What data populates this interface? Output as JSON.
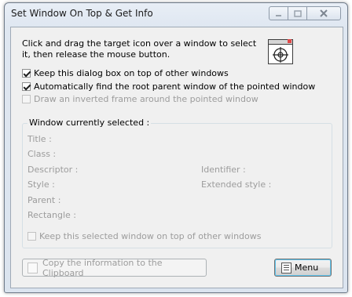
{
  "window": {
    "title": "Set Window On Top & Get Info"
  },
  "instructions": "Click and drag the target icon over a window to select it, then release the mouse button.",
  "options": [
    {
      "label": "Keep this dialog box on top of other windows",
      "checked": true,
      "enabled": true
    },
    {
      "label": "Automatically find the root parent window of the pointed window",
      "checked": true,
      "enabled": true
    },
    {
      "label": "Draw an inverted frame around the pointed window",
      "checked": false,
      "enabled": false
    }
  ],
  "group": {
    "legend": "Window currently selected :",
    "fields": {
      "title": "Title :",
      "class": "Class :",
      "descriptor": "Descriptor :",
      "identifier": "Identifier :",
      "style": "Style :",
      "extended_style": "Extended style :",
      "parent": "Parent :",
      "rectangle": "Rectangle :"
    },
    "keep_on_top": {
      "label": "Keep this selected window on top of other windows",
      "checked": false,
      "enabled": false
    }
  },
  "buttons": {
    "copy": "Copy the information to the Clipboard",
    "menu": "Menu"
  },
  "icons": {
    "target": "crosshair-target-icon",
    "clipboard": "clipboard-icon",
    "menu": "menu-list-icon"
  },
  "colors": {
    "window_frame": "#dbe4ef",
    "client_bg": "#f0f0f0",
    "disabled_text": "#9c9c9c",
    "default_button_glow": "#5ec4ee"
  }
}
